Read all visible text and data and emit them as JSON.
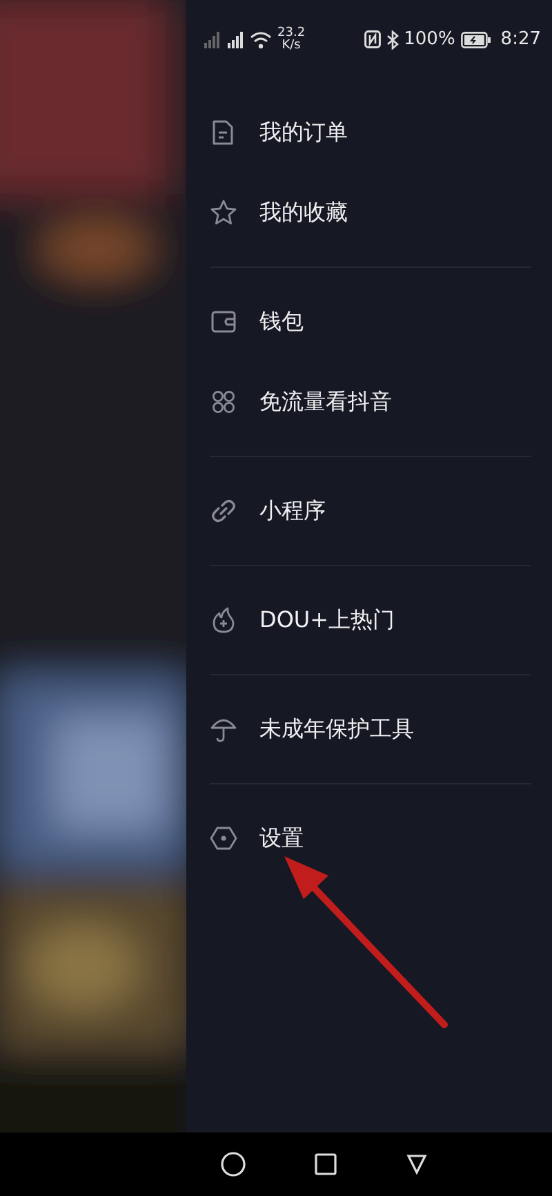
{
  "status_bar": {
    "network_speed": "23.2",
    "speed_unit": "K/s",
    "battery": "100%",
    "time": "8:27"
  },
  "menu_groups": [
    {
      "items": [
        {
          "kind": "document",
          "label": "我的订单"
        },
        {
          "kind": "star",
          "label": "我的收藏"
        }
      ]
    },
    {
      "items": [
        {
          "kind": "wallet",
          "label": "钱包"
        },
        {
          "kind": "grid",
          "label": "免流量看抖音"
        }
      ]
    },
    {
      "items": [
        {
          "kind": "link",
          "label": "小程序"
        }
      ]
    },
    {
      "items": [
        {
          "kind": "flame",
          "label": "DOU+上热门"
        }
      ]
    },
    {
      "items": [
        {
          "kind": "umbrella",
          "label": "未成年保护工具"
        }
      ]
    },
    {
      "items": [
        {
          "kind": "hexagon",
          "label": "设置"
        }
      ]
    }
  ]
}
